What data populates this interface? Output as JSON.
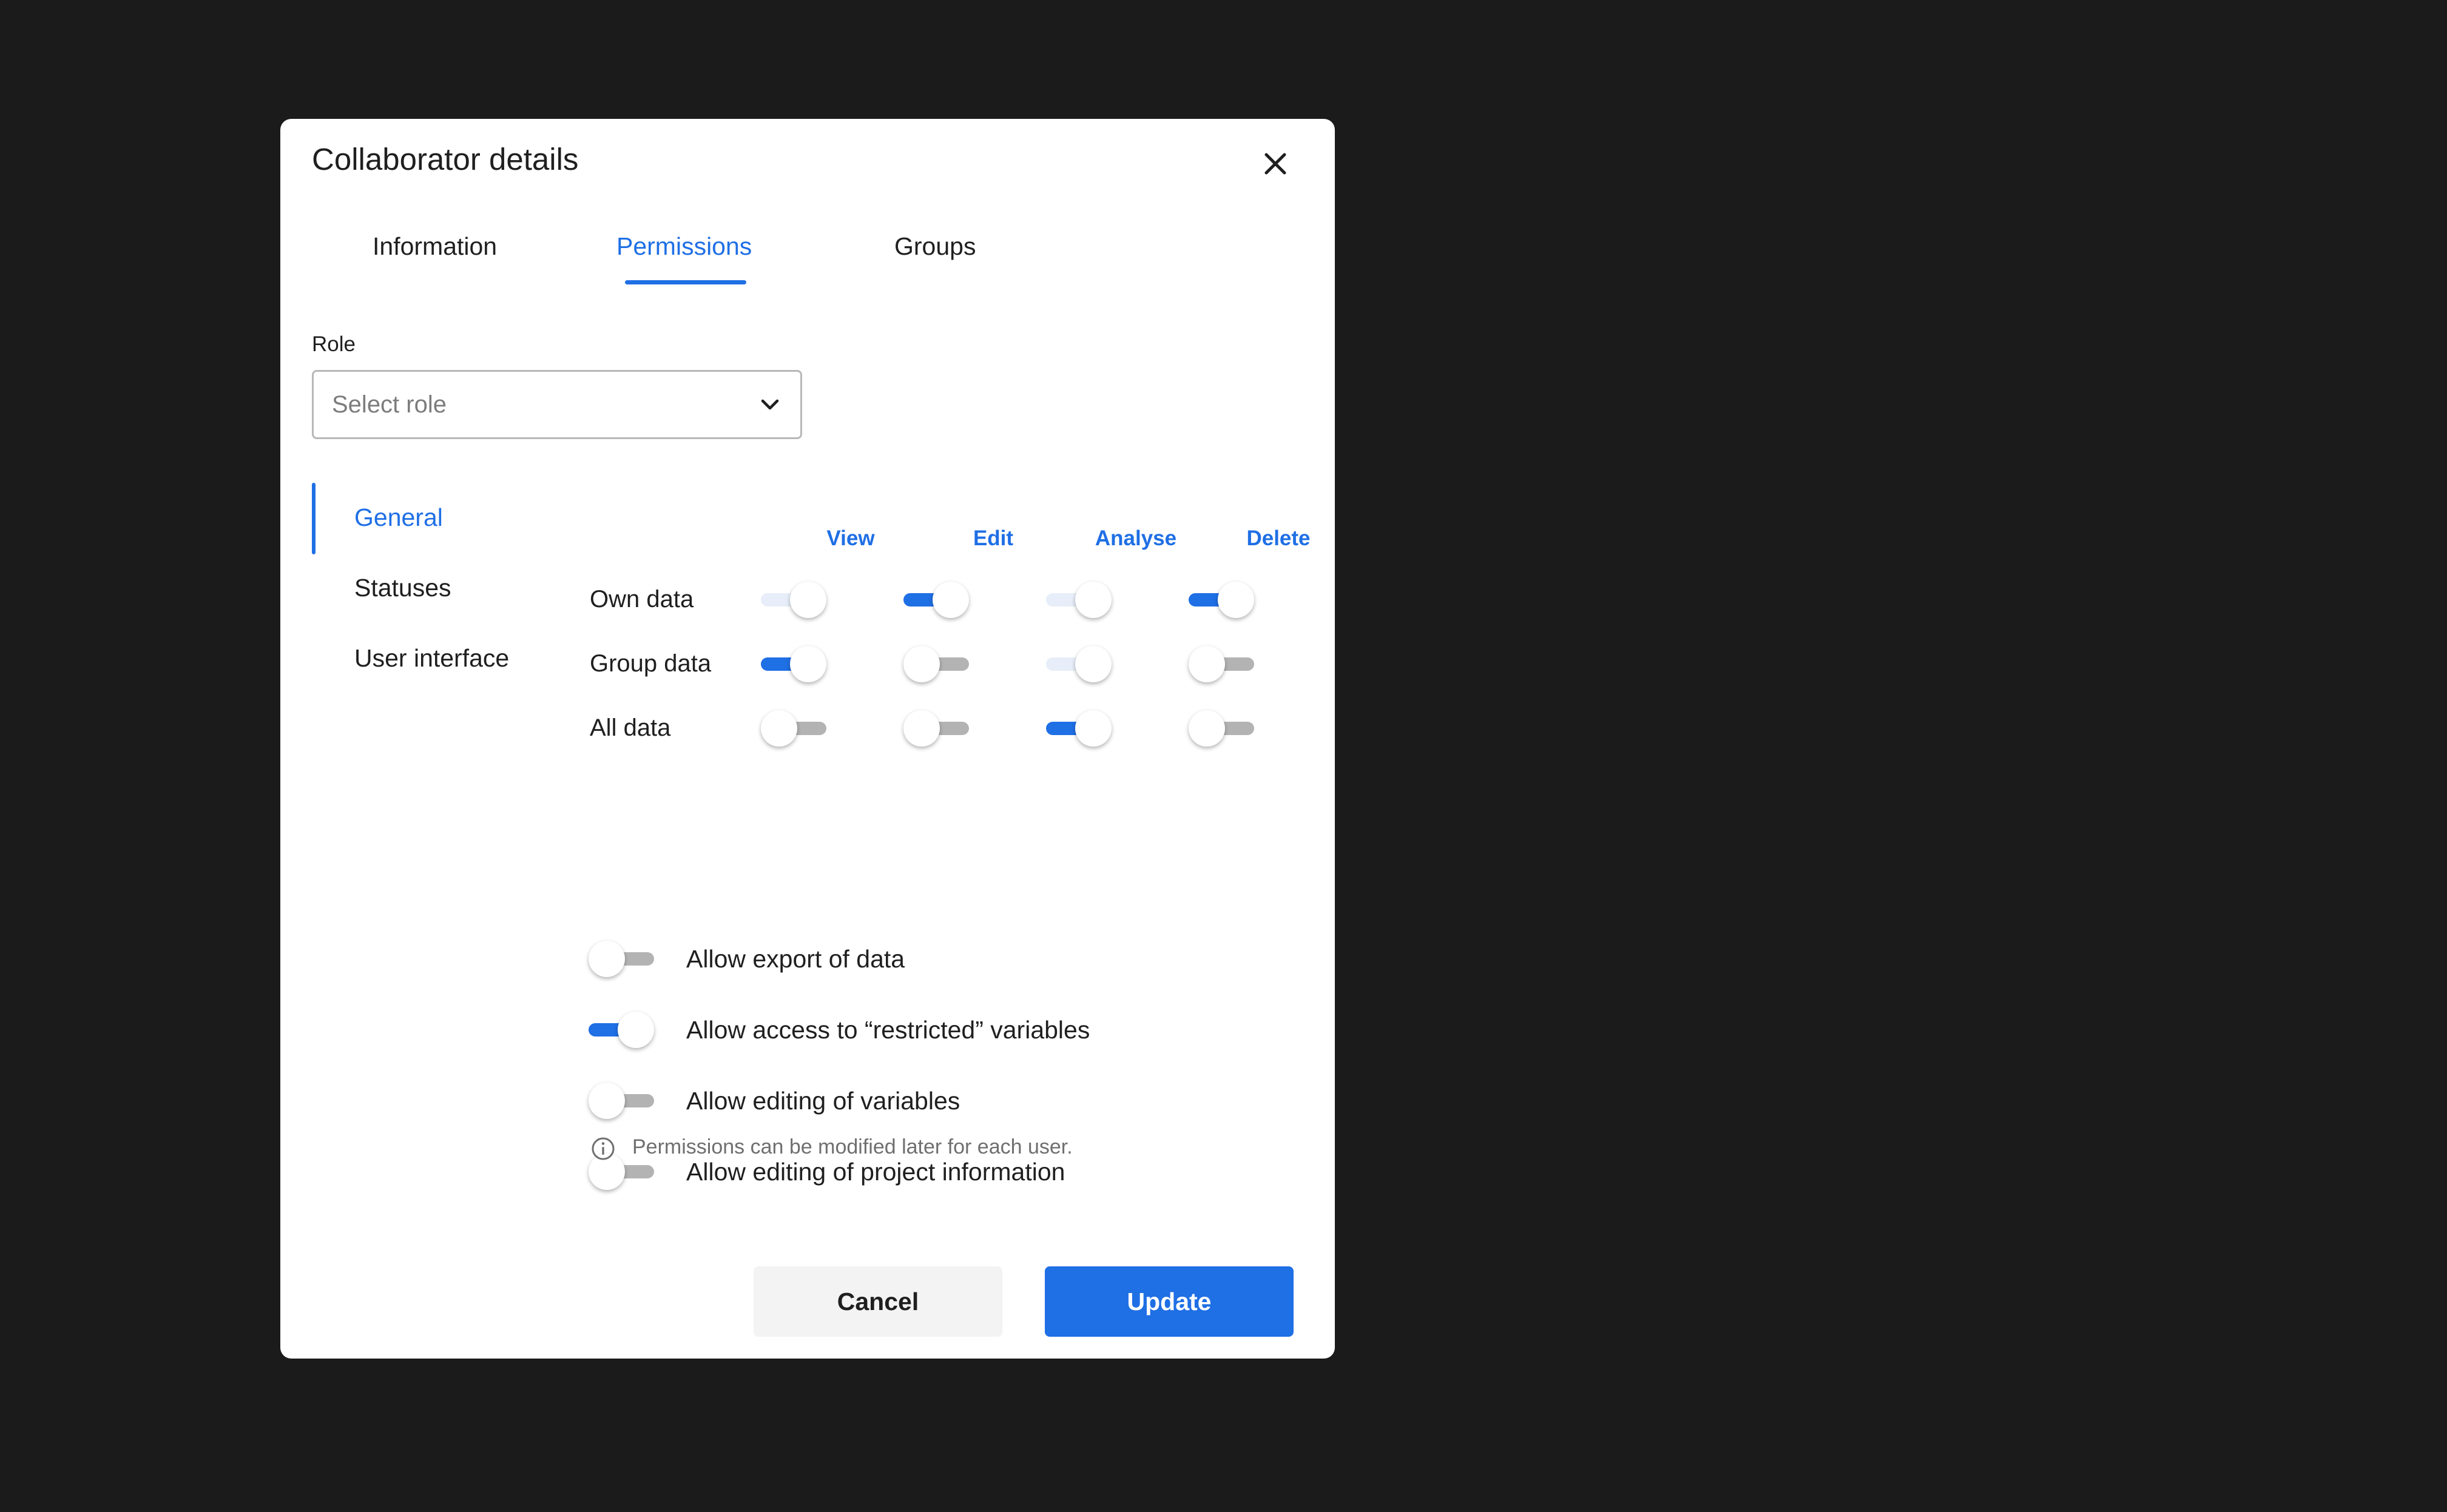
{
  "dialog": {
    "title": "Collaborator details",
    "close_icon": "close-icon"
  },
  "tabs": [
    {
      "label": "Information",
      "active": false
    },
    {
      "label": "Permissions",
      "active": true
    },
    {
      "label": "Groups",
      "active": false
    }
  ],
  "role": {
    "label": "Role",
    "placeholder": "Select role",
    "icon": "chevron-down-icon"
  },
  "sidebar": {
    "items": [
      {
        "label": "General",
        "active": true
      },
      {
        "label": "Statuses",
        "active": false
      },
      {
        "label": "User interface",
        "active": false
      }
    ]
  },
  "permissions": {
    "columns": [
      "View",
      "Edit",
      "Analyse",
      "Delete"
    ],
    "rows": [
      {
        "label": "Own data",
        "states": [
          "disabled-on",
          "on",
          "disabled-on",
          "on"
        ]
      },
      {
        "label": "Group data",
        "states": [
          "on",
          "off",
          "disabled-on",
          "off"
        ]
      },
      {
        "label": "All data",
        "states": [
          "off",
          "off",
          "on",
          "off"
        ]
      }
    ]
  },
  "options": [
    {
      "label": "Allow export of data",
      "state": "off"
    },
    {
      "label": "Allow access to “restricted” variables",
      "state": "on"
    },
    {
      "label": "Allow editing of variables",
      "state": "off"
    },
    {
      "label": "Allow editing of project information",
      "state": "off"
    }
  ],
  "info": {
    "icon": "info-icon",
    "text": "Permissions can be modified later for each user."
  },
  "buttons": {
    "cancel": "Cancel",
    "update": "Update"
  },
  "colors": {
    "accent": "#1f6fe5",
    "backdrop": "#1b1b1b",
    "toggle_off_track": "#b3b3b3",
    "toggle_disabled_track": "#e7eef9"
  }
}
